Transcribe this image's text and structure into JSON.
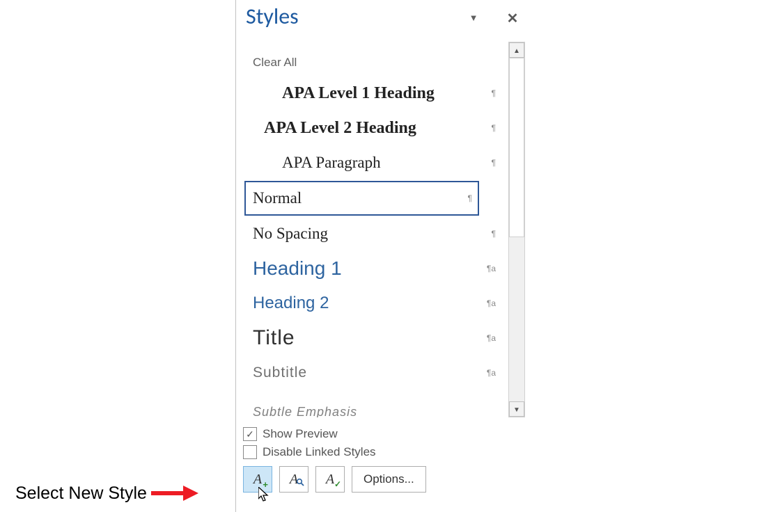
{
  "annotation": {
    "text": "Select New Style"
  },
  "pane": {
    "title": "Styles",
    "styles": [
      {
        "label": "Clear All",
        "marker": ""
      },
      {
        "label": "APA Level 1 Heading",
        "marker": "¶"
      },
      {
        "label": "APA Level 2 Heading",
        "marker": "¶"
      },
      {
        "label": "APA Paragraph",
        "marker": "¶"
      },
      {
        "label": "Normal",
        "marker": "¶"
      },
      {
        "label": "No Spacing",
        "marker": "¶"
      },
      {
        "label": "Heading 1",
        "marker": "¶a"
      },
      {
        "label": "Heading 2",
        "marker": "¶a"
      },
      {
        "label": "Title",
        "marker": "¶a"
      },
      {
        "label": "Subtitle",
        "marker": "¶a"
      },
      {
        "label": "Subtle Emphasis",
        "marker": ""
      }
    ],
    "show_preview": {
      "label": "Show Preview",
      "checked": true
    },
    "disable_linked": {
      "label": "Disable Linked Styles",
      "checked": false
    },
    "options_label": "Options..."
  }
}
